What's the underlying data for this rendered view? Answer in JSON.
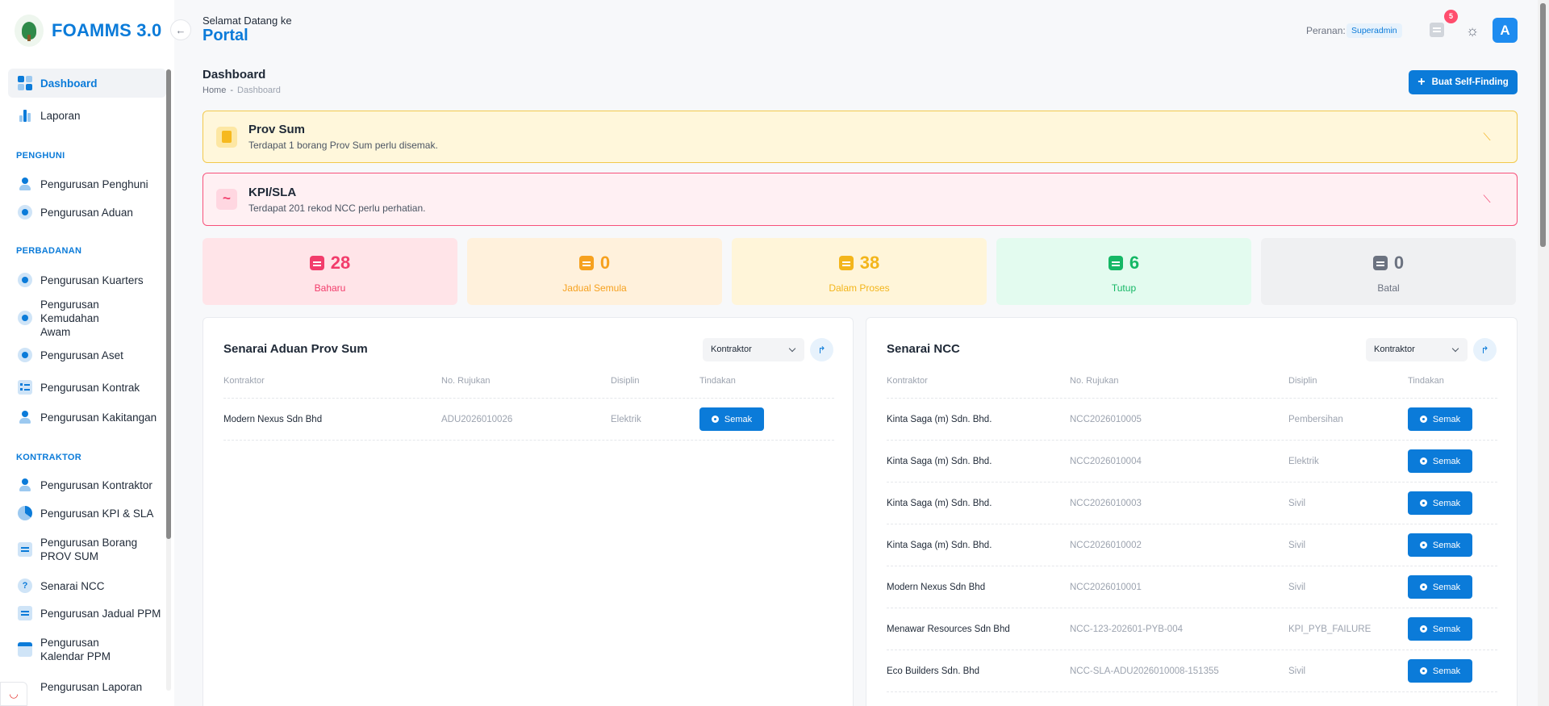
{
  "brand": {
    "name": "FOAMMS 3.0"
  },
  "sidebar": {
    "items": [
      {
        "label": "Dashboard",
        "icon": "grid-icon"
      },
      {
        "label": "Laporan",
        "icon": "bar-chart-icon"
      },
      {
        "label": "Pengurusan Penghuni",
        "icon": "user-icon"
      },
      {
        "label": "Pengurusan Aduan",
        "icon": "complaint-icon"
      },
      {
        "label": "Pengurusan Kuarters",
        "icon": "home-icon"
      },
      {
        "label": "Pengurusan Kemudahan Awam",
        "icon": "facility-icon"
      },
      {
        "label": "Pengurusan Aset",
        "icon": "asset-icon"
      },
      {
        "label": "Pengurusan Kontrak",
        "icon": "checklist-icon"
      },
      {
        "label": "Pengurusan Kakitangan",
        "icon": "staff-icon"
      },
      {
        "label": "Pengurusan Kontraktor",
        "icon": "user-icon"
      },
      {
        "label": "Pengurusan KPI & SLA",
        "icon": "pie-chart-icon"
      },
      {
        "label": "Pengurusan Borang PROV SUM",
        "icon": "document-icon"
      },
      {
        "label": "Senarai NCC",
        "icon": "question-icon"
      },
      {
        "label": "Pengurusan Jadual PPM",
        "icon": "document-icon"
      },
      {
        "label": "Pengurusan Kalendar PPM",
        "icon": "calendar-icon"
      },
      {
        "label": "Pengurusan Laporan",
        "icon": "document-icon"
      }
    ],
    "sections": [
      "PENGHUNI",
      "PERBADANAN",
      "KONTRAKTOR"
    ]
  },
  "header": {
    "welcome": "Selamat Datang ke",
    "portal": "Portal",
    "role_label": "Peranan:",
    "role_value": "Superadmin",
    "notification_count": "5",
    "avatar_letter": "A"
  },
  "page": {
    "title": "Dashboard",
    "breadcrumb": [
      "Home",
      "-",
      "Dashboard"
    ],
    "cta_label": "Buat Self-Finding"
  },
  "alerts": [
    {
      "title": "Prov Sum",
      "message": "Terdapat 1 borang Prov Sum perlu disemak.",
      "color": "#f2c94c"
    },
    {
      "title": "KPI/SLA",
      "message": "Terdapat 201 rekod NCC perlu perhatian.",
      "color": "#f7517a"
    }
  ],
  "stats": [
    {
      "value": "28",
      "label": "Baharu",
      "bg": "#ffe4e8",
      "color": "#f23c6b"
    },
    {
      "value": "0",
      "label": "Jadual Semula",
      "bg": "#fff1dc",
      "color": "#f6a11f"
    },
    {
      "value": "38",
      "label": "Dalam Proses",
      "bg": "#fff5d9",
      "color": "#f3b51b"
    },
    {
      "value": "6",
      "label": "Tutup",
      "bg": "#e3fbef",
      "color": "#15b765"
    },
    {
      "value": "0",
      "label": "Batal",
      "bg": "#eff0f2",
      "color": "#6b7280"
    }
  ],
  "provsum": {
    "title": "Senarai Aduan Prov Sum",
    "filter": "Kontraktor",
    "headers": [
      "Kontraktor",
      "No. Rujukan",
      "Disiplin",
      "Tindakan"
    ],
    "rows": [
      {
        "kontraktor": "Modern Nexus Sdn Bhd",
        "rujukan": "ADU2026010026",
        "disiplin": "Elektrik",
        "action": "Semak"
      }
    ]
  },
  "ncc": {
    "title": "Senarai NCC",
    "filter": "Kontraktor",
    "headers": [
      "Kontraktor",
      "No. Rujukan",
      "Disiplin",
      "Tindakan"
    ],
    "rows": [
      {
        "kontraktor": "Kinta Saga (m) Sdn. Bhd.",
        "rujukan": "NCC2026010005",
        "disiplin": "Pembersihan",
        "action": "Semak"
      },
      {
        "kontraktor": "Kinta Saga (m) Sdn. Bhd.",
        "rujukan": "NCC2026010004",
        "disiplin": "Elektrik",
        "action": "Semak"
      },
      {
        "kontraktor": "Kinta Saga (m) Sdn. Bhd.",
        "rujukan": "NCC2026010003",
        "disiplin": "Sivil",
        "action": "Semak"
      },
      {
        "kontraktor": "Kinta Saga (m) Sdn. Bhd.",
        "rujukan": "NCC2026010002",
        "disiplin": "Sivil",
        "action": "Semak"
      },
      {
        "kontraktor": "Modern Nexus Sdn Bhd",
        "rujukan": "NCC2026010001",
        "disiplin": "Sivil",
        "action": "Semak"
      },
      {
        "kontraktor": "Menawar Resources Sdn Bhd",
        "rujukan": "NCC-123-202601-PYB-004",
        "disiplin": "KPI_PYB_FAILURE",
        "action": "Semak"
      },
      {
        "kontraktor": "Eco Builders Sdn. Bhd",
        "rujukan": "NCC-SLA-ADU2026010008-151355",
        "disiplin": "Sivil",
        "action": "Semak"
      }
    ]
  },
  "colors": {
    "primary": "#0b7bd9",
    "badge": "#ff4d6d"
  }
}
